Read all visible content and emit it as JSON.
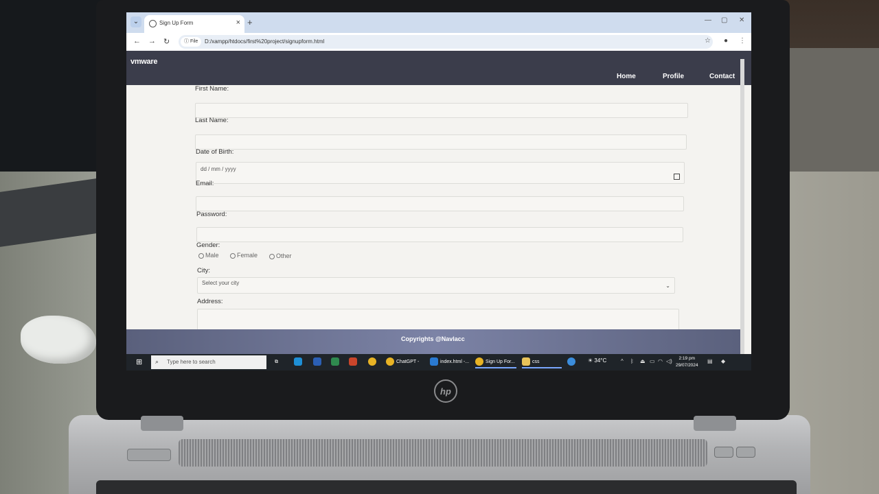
{
  "browser": {
    "tab_title": "Sign Up Form",
    "new_tab_symbol": "+",
    "file_chip": "File",
    "url": "D:/xampp/htdocs/first%20project/signupform.html"
  },
  "site": {
    "brand": "vmware",
    "nav": [
      "Home",
      "Profile",
      "Contact"
    ]
  },
  "form": {
    "first_name_label": "First Name:",
    "last_name_label": "Last Name:",
    "dob_label": "Date of Birth:",
    "dob_placeholder": "dd / mm / yyyy",
    "email_label": "Email:",
    "password_label": "Password:",
    "gender_label": "Gender:",
    "gender_options": [
      "Male",
      "Female",
      "Other"
    ],
    "city_label": "City:",
    "city_placeholder": "Select your city",
    "address_label": "Address:"
  },
  "footer": {
    "text": "Copyrights @Navlacc"
  },
  "taskbar": {
    "search_placeholder": "Type here to search",
    "apps": [
      "ChatGPT - G...",
      "index.html -...",
      "Sign Up For...",
      "css"
    ],
    "temperature": "34°C",
    "time": "2:19 pm",
    "date": "29/07/2024"
  },
  "laptop": {
    "logo": "hp"
  },
  "colors": {
    "navbar": "#3b3d4b",
    "footer": "#6b7194",
    "taskbar": "#1f2429"
  }
}
